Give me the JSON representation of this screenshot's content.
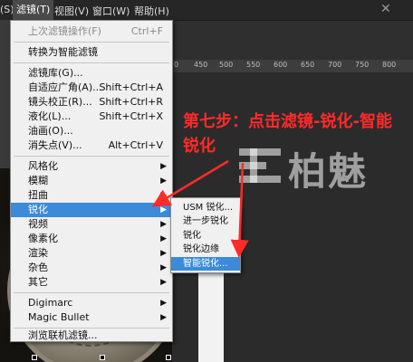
{
  "menubar": {
    "items": [
      {
        "label": "(S)"
      },
      {
        "label": "滤镜(T)"
      },
      {
        "label": "视图(V)"
      },
      {
        "label": "窗口(W)"
      },
      {
        "label": "帮助(H)"
      }
    ]
  },
  "ruler": {
    "ticks": [
      "0",
      "450",
      "500",
      "550",
      "600",
      "650",
      "700",
      "750",
      "800"
    ]
  },
  "filter_menu": {
    "items": [
      {
        "label": "上次滤镜操作(F)",
        "shortcut": "Ctrl+F"
      },
      {
        "label": "转换为智能滤镜"
      },
      {
        "label": "滤镜库(G)..."
      },
      {
        "label": "自适应广角(A)...",
        "shortcut": "Shift+Ctrl+A"
      },
      {
        "label": "镜头校正(R)...",
        "shortcut": "Shift+Ctrl+R"
      },
      {
        "label": "液化(L)...",
        "shortcut": "Shift+Ctrl+X"
      },
      {
        "label": "油画(O)..."
      },
      {
        "label": "消失点(V)...",
        "shortcut": "Alt+Ctrl+V"
      },
      {
        "label": "风格化"
      },
      {
        "label": "模糊"
      },
      {
        "label": "扭曲"
      },
      {
        "label": "锐化"
      },
      {
        "label": "视频"
      },
      {
        "label": "像素化"
      },
      {
        "label": "渲染"
      },
      {
        "label": "杂色"
      },
      {
        "label": "其它"
      },
      {
        "label": "Digimarc"
      },
      {
        "label": "Magic Bullet"
      },
      {
        "label": "浏览联机滤镜..."
      }
    ]
  },
  "sharpen_submenu": {
    "items": [
      {
        "label": "USM 锐化..."
      },
      {
        "label": "进一步锐化"
      },
      {
        "label": "锐化"
      },
      {
        "label": "锐化边缘"
      },
      {
        "label": "智能锐化..."
      }
    ]
  },
  "annotation": {
    "text": "第七步：点击滤镜-锐化-智能锐化"
  },
  "watermark": {
    "text": "柏魅"
  },
  "colors": {
    "highlight": "#3b8bd9",
    "annotation": "#ff2a2a"
  }
}
